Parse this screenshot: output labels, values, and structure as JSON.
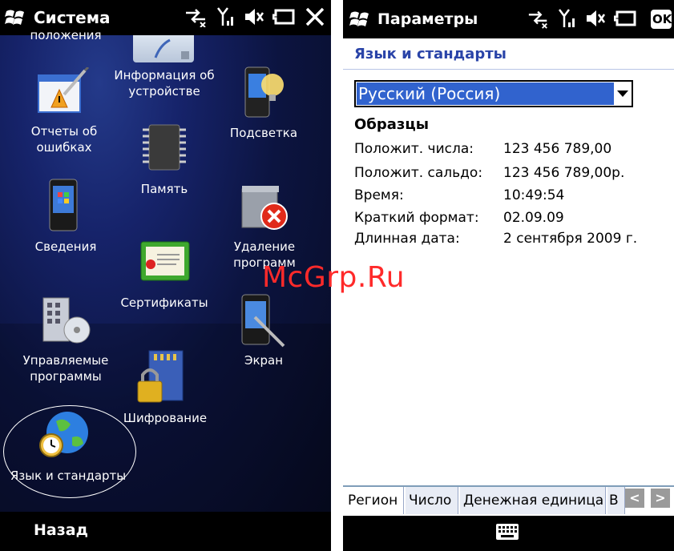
{
  "left": {
    "title": "Система",
    "back_label": "Назад",
    "tiles": {
      "location_partial": "положения",
      "device_info": "Информация об устройстве",
      "error_reports": "Отчеты об ошибках",
      "backlight": "Подсветка",
      "memory": "Память",
      "about": "Сведения",
      "remove_programs": "Удаление программ",
      "certificates": "Сертификаты",
      "managed_programs": "Управляемые программы",
      "screen": "Экран",
      "encryption": "Шифрование",
      "regional_settings": "Язык и стандарты"
    }
  },
  "right": {
    "title": "Параметры",
    "ok_label": "OK",
    "header": "Язык и стандарты",
    "locale_selected": "Русский (Россия)",
    "samples_title": "Образцы",
    "samples": [
      {
        "label": "Положит. числа:",
        "value": "123 456 789,00"
      },
      {
        "label": "Положит. сальдо:",
        "value": "123 456 789,00р."
      },
      {
        "label": "Время:",
        "value": "10:49:54"
      },
      {
        "label": "Краткий формат:",
        "value": "02.09.09"
      },
      {
        "label": "Длинная дата:",
        "value": "2 сентября 2009 г."
      }
    ],
    "tabs": [
      "Регион",
      "Число",
      "Денежная единица",
      "В"
    ],
    "tab_prev": "<",
    "tab_next": ">"
  },
  "watermark": "McGrp.Ru",
  "colors": {
    "accent_blue": "#3163ce",
    "header_blue": "#2a44a8",
    "watermark_red": "#ff2a2a"
  }
}
